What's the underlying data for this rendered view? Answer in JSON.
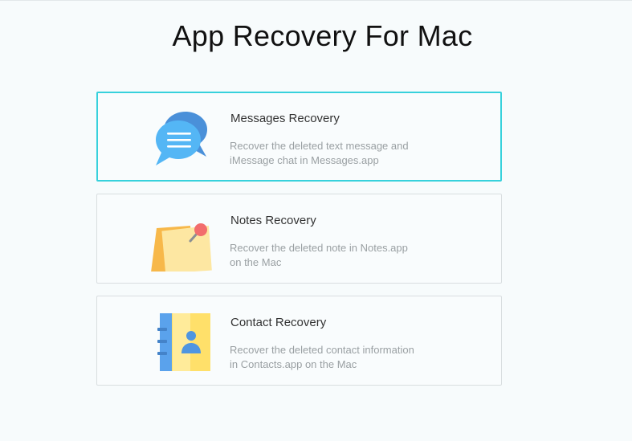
{
  "page": {
    "title": "App Recovery For Mac"
  },
  "cards": [
    {
      "title": "Messages Recovery",
      "desc_line1": "Recover the deleted text message and",
      "desc_line2": "iMessage chat in Messages.app",
      "icon": "messages-bubble-icon",
      "selected": true
    },
    {
      "title": "Notes Recovery",
      "desc_line1": "Recover the deleted note in Notes.app",
      "desc_line2": "on the Mac",
      "icon": "sticky-note-icon",
      "selected": false
    },
    {
      "title": "Contact Recovery",
      "desc_line1": "Recover the deleted contact information",
      "desc_line2": "in Contacts.app on the Mac",
      "icon": "contact-book-icon",
      "selected": false
    }
  ],
  "colors": {
    "selected_border": "#38d1dc",
    "card_border": "#d9dee0",
    "background": "#f7fbfc"
  }
}
